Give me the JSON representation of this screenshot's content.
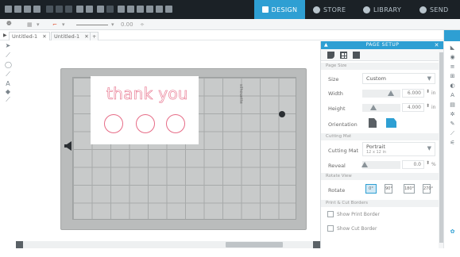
{
  "nav": {
    "design": "DESIGN",
    "store": "STORE",
    "library": "LIBRARY",
    "send": "SEND"
  },
  "toolbar2": {
    "line_width": "0.00"
  },
  "doc_tabs": [
    "Untitled-1",
    "Untitled-1"
  ],
  "canvas": {
    "design_text": "thank you",
    "brand_label": "silhouette"
  },
  "panel": {
    "header": "PAGE SETUP",
    "media_section": "Page Size",
    "size_label": "Size",
    "size_value": "Custom",
    "width_label": "Width",
    "width_value": "6.000",
    "width_unit": "in",
    "height_label": "Height",
    "height_value": "4.000",
    "height_unit": "in",
    "orientation_label": "Orientation",
    "cutting_section": "Cutting Mat",
    "cutting_mat_label": "Cutting Mat",
    "cutting_mat_value": "Portrait",
    "cutting_mat_sub": "12 x 12 in",
    "reveal_label": "Reveal",
    "reveal_value": "0.0",
    "reveal_unit": "%",
    "rotate_section": "Rotate View",
    "rotate_label": "Rotate",
    "rotate_options": [
      "0°",
      "90°",
      "180°",
      "270°"
    ],
    "print_section": "Print & Cut Borders",
    "show_print_border": "Show Print Border",
    "show_cut_border": "Show Cut Border"
  },
  "colors": {
    "accent": "#2e9fd3",
    "topbar": "#1b2126",
    "design_stroke": "#e66b86",
    "mat": "#babcbc"
  }
}
